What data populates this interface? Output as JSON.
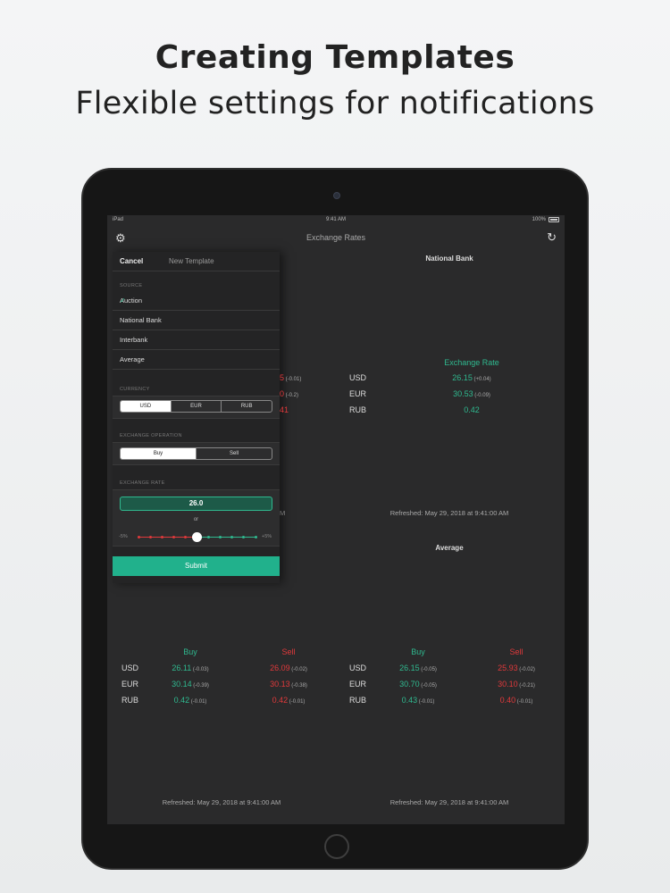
{
  "hero": {
    "title": "Creating Templates",
    "subtitle": "Flexible settings for notifications"
  },
  "status_bar": {
    "device": "iPad",
    "time": "9:41 AM",
    "battery": "100%"
  },
  "nav": {
    "title": "Exchange Rates"
  },
  "top_right": {
    "bank": "National Bank",
    "header": "Exchange Rate",
    "rows": [
      {
        "currency": "USD",
        "rate": "26.15",
        "change": "(+0.04)"
      },
      {
        "currency": "EUR",
        "rate": "30.53",
        "change": "(-0.09)"
      },
      {
        "currency": "RUB",
        "rate": "0.42",
        "change": ""
      }
    ],
    "refreshed": "Refreshed: May 29, 2018 at 9:41:00 AM"
  },
  "top_left_partial": {
    "header": "ell",
    "rows": [
      {
        "value": "5",
        "change": "(-0.01)"
      },
      {
        "value": "0",
        "change": "(-0.2)"
      },
      {
        "value": "41",
        "change": ""
      }
    ],
    "refreshed_tail": "M"
  },
  "average_label": "Average",
  "bottom_left": {
    "buy_header": "Buy",
    "sell_header": "Sell",
    "rows": [
      {
        "currency": "USD",
        "buy": "26.11",
        "buy_change": "(-0.03)",
        "sell": "26.09",
        "sell_change": "(-0.02)"
      },
      {
        "currency": "EUR",
        "buy": "30.14",
        "buy_change": "(-0.39)",
        "sell": "30.13",
        "sell_change": "(-0.38)"
      },
      {
        "currency": "RUB",
        "buy": "0.42",
        "buy_change": "(-0.01)",
        "sell": "0.42",
        "sell_change": "(-0.01)"
      }
    ],
    "refreshed": "Refreshed: May 29, 2018 at 9:41:00 AM"
  },
  "bottom_right": {
    "buy_header": "Buy",
    "sell_header": "Sell",
    "rows": [
      {
        "currency": "USD",
        "buy": "26.15",
        "buy_change": "(-0.05)",
        "sell": "25.93",
        "sell_change": "(-0.02)"
      },
      {
        "currency": "EUR",
        "buy": "30.70",
        "buy_change": "(-0.05)",
        "sell": "30.10",
        "sell_change": "(-0.21)"
      },
      {
        "currency": "RUB",
        "buy": "0.43",
        "buy_change": "(-0.01)",
        "sell": "0.40",
        "sell_change": "(-0.01)"
      }
    ],
    "refreshed": "Refreshed: May 29, 2018 at 9:41:00 AM"
  },
  "template_panel": {
    "cancel": "Cancel",
    "title": "New Template",
    "source_label": "SOURCE",
    "sources": [
      "Auction",
      "National Bank",
      "Interbank",
      "Average"
    ],
    "selected_source": "Auction",
    "currency_label": "CURRENCY",
    "currencies": [
      "USD",
      "EUR",
      "RUB"
    ],
    "selected_currency": "USD",
    "operation_label": "EXCHANGE OPERATION",
    "operations": [
      "Buy",
      "Sell"
    ],
    "selected_operation": "Buy",
    "rate_label": "EXCHANGE RATE",
    "rate_value": "26.0",
    "or_label": "or",
    "slider_min": "-5%",
    "slider_max": "+5%",
    "slider_value_pct": 0,
    "submit": "Submit"
  },
  "colors": {
    "accent_green": "#2fb98f",
    "sell_red": "#e0393b",
    "submit": "#21b18c"
  }
}
